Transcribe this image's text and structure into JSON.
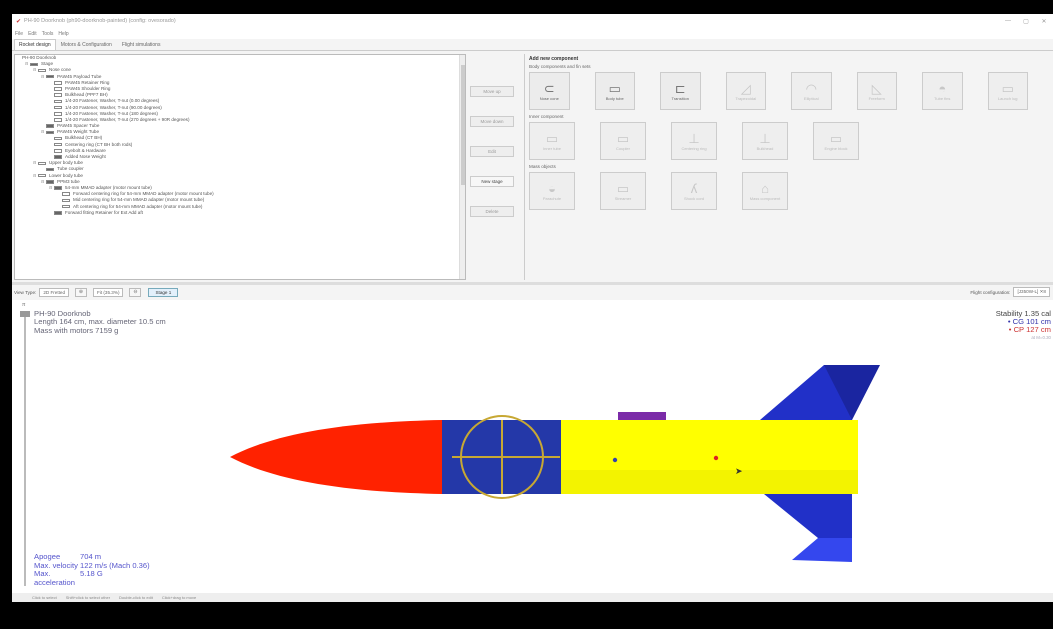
{
  "window": {
    "title": "PH-90 Doorknob (ph90-doorknob-painted) (config: ovesorado)",
    "min": "—",
    "close": "✕"
  },
  "menu": [
    "File",
    "Edit",
    "Tools",
    "Help"
  ],
  "tabs": [
    "Rocket design",
    "Motors & Configuration",
    "Flight simulations"
  ],
  "tree": [
    {
      "depth": 0,
      "label": "PH-90 Doorknob",
      "icon": "none"
    },
    {
      "depth": 1,
      "label": "Stage",
      "icon": "stage",
      "exp": "⊟"
    },
    {
      "depth": 2,
      "label": "Nose cone",
      "icon": "nose",
      "exp": "⊟"
    },
    {
      "depth": 3,
      "label": "PAW45 Payload Tube",
      "icon": "tube",
      "exp": "⊟"
    },
    {
      "depth": 4,
      "label": "PAW45 Retainer Ring",
      "icon": "ring"
    },
    {
      "depth": 4,
      "label": "PAW45 Shoulder Ring",
      "icon": "ring"
    },
    {
      "depth": 4,
      "label": "Bulkhead (PPF7 BH)",
      "icon": "ring"
    },
    {
      "depth": 4,
      "label": "1/4-20 Fastener, Washer, T-nut (0.00 degrees)",
      "icon": "mass"
    },
    {
      "depth": 4,
      "label": "1/4-20 Fastener, Washer, T-nut (90.00 degrees)",
      "icon": "mass"
    },
    {
      "depth": 4,
      "label": "1/4-20 Fastener, Washer, T-nut (180 degrees)",
      "icon": "mass"
    },
    {
      "depth": 4,
      "label": "1/4-20 Fastener, Washer, T-nut (270 degrees + 90R degrees)",
      "icon": "mass"
    },
    {
      "depth": 3,
      "label": "PAW45 Spacer Tube",
      "icon": "tube"
    },
    {
      "depth": 3,
      "label": "PAW45 Weight Tube",
      "icon": "tube",
      "exp": "⊟"
    },
    {
      "depth": 4,
      "label": "Bulkhead (CT BH)",
      "icon": "ring"
    },
    {
      "depth": 4,
      "label": "Centering ring (CT BH both rods)",
      "icon": "ring"
    },
    {
      "depth": 4,
      "label": "Eyebolt & Hardware",
      "icon": "mass"
    },
    {
      "depth": 4,
      "label": "Added Nose Weight",
      "icon": "weight"
    },
    {
      "depth": 2,
      "label": "Upper body tube",
      "icon": "nose",
      "exp": "⊟"
    },
    {
      "depth": 3,
      "label": "Tube coupler",
      "icon": "tube"
    },
    {
      "depth": 2,
      "label": "Lower body tube",
      "icon": "nose",
      "exp": "⊟"
    },
    {
      "depth": 3,
      "label": "PPM3 tube",
      "icon": "tube",
      "exp": "⊟"
    },
    {
      "depth": 4,
      "label": "54-mm MMAD adapter (motor mount tube)",
      "icon": "tube",
      "exp": "⊟"
    },
    {
      "depth": 5,
      "label": "Forward centering ring for 54-mm MMAD adapter (motor mount tube)",
      "icon": "ring"
    },
    {
      "depth": 5,
      "label": "Mid centering ring for 54-mm MMAD adapter (motor mount tube)",
      "icon": "ring"
    },
    {
      "depth": 5,
      "label": "Aft centering ring for 54-mm MMAD adapter (motor mount tube)",
      "icon": "ring"
    },
    {
      "depth": 4,
      "label": "Forward fitting Retainer for Ext Add aft",
      "icon": "tube"
    }
  ],
  "tree_buttons": [
    {
      "label": "Move up",
      "enabled": false
    },
    {
      "label": "Move down",
      "enabled": false
    },
    {
      "label": "Edit",
      "enabled": false
    },
    {
      "label": "New stage",
      "enabled": true
    },
    {
      "label": "Delete",
      "enabled": false
    }
  ],
  "add_panel": {
    "title": "Add new component",
    "sections": [
      {
        "label": "Body components and fin sets",
        "items": [
          {
            "label": "Nose cone",
            "glyph": "⊂",
            "dim": false
          },
          {
            "label": "Body tube",
            "glyph": "▭",
            "dim": false
          },
          {
            "label": "Transition",
            "glyph": "⊏",
            "dim": false
          },
          {
            "label": "Trapezoidal",
            "glyph": "◿",
            "dim": true
          },
          {
            "label": "Elliptical",
            "glyph": "◠",
            "dim": true
          },
          {
            "label": "Freeform",
            "glyph": "◺",
            "dim": true
          },
          {
            "label": "Tube fins",
            "glyph": "◓",
            "dim": true
          },
          {
            "label": "Launch lug",
            "glyph": "▭",
            "dim": true
          }
        ]
      },
      {
        "label": "Inner component",
        "items": [
          {
            "label": "Inner tube",
            "glyph": "▭",
            "dim": true
          },
          {
            "label": "Coupler",
            "glyph": "▭",
            "dim": true
          },
          {
            "label": "Centering ring",
            "glyph": "⊥",
            "dim": true
          },
          {
            "label": "Bulkhead",
            "glyph": "⊥",
            "dim": true
          },
          {
            "label": "Engine block",
            "glyph": "▭",
            "dim": true
          }
        ]
      },
      {
        "label": "Mass objects",
        "items": [
          {
            "label": "Parachute",
            "glyph": "◒",
            "dim": true
          },
          {
            "label": "Streamer",
            "glyph": "▭",
            "dim": true
          },
          {
            "label": "Shock cord",
            "glyph": "ʎ",
            "dim": true
          },
          {
            "label": "Mass component",
            "glyph": "⌂",
            "dim": true
          }
        ]
      }
    ]
  },
  "viewbar": {
    "view_type_label": "View Type:",
    "view_type_value": "2D Fretted",
    "zoom_value": "Fit (35.3%)",
    "stage_label": "Stage 1",
    "flight_config_label": "Flight configuration:",
    "flight_config_value": "[J350W-L] ✕8"
  },
  "rocket_info": {
    "name": "PH-90 Doorknob",
    "length_line": "Length 164 cm, max. diameter 10.5 cm",
    "mass_line": "Mass with motors 7159 g"
  },
  "stability": {
    "stability_line": "Stability 1.35 cal",
    "cg_line": "CG 101 cm",
    "cp_line": "CP 127 cm",
    "mach_line": "at M=0.30"
  },
  "flight": [
    {
      "key": "Apogee",
      "value": "704 m"
    },
    {
      "key": "Max. velocity",
      "value": "122 m/s  (Mach 0.36)"
    },
    {
      "key": "Max. acceleration",
      "value": "5.18 G"
    }
  ],
  "status_hints": [
    "Click to select",
    "Shift+click to select other",
    "Double-click to edit",
    "Click+drag to move"
  ],
  "colors": {
    "nose": "#ff2200",
    "band": "#2438a8",
    "body": "#ffff00",
    "fins": "#2130c8",
    "lug": "#7b2ba8"
  }
}
